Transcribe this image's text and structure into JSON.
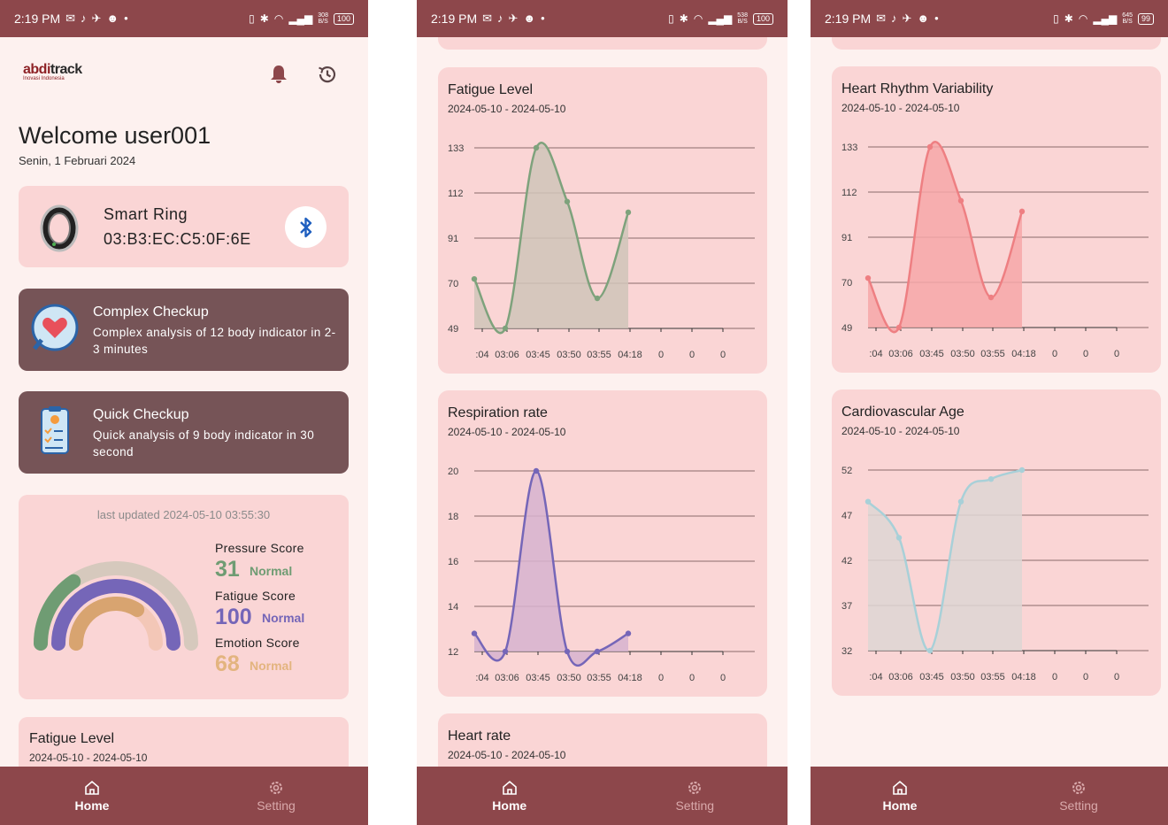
{
  "statusbar": {
    "p1": {
      "time": "2:19 PM",
      "speed_top": "308",
      "speed_bottom": "B/S",
      "battery": "100"
    },
    "p2": {
      "time": "2:19 PM",
      "speed_top": "538",
      "speed_bottom": "B/S",
      "battery": "100"
    },
    "p3": {
      "time": "2:19 PM",
      "speed_top": "645",
      "speed_bottom": "B/S",
      "battery": "99"
    }
  },
  "nav": {
    "home": "Home",
    "setting": "Setting"
  },
  "home": {
    "logo_main_a": "abdi",
    "logo_main_b": "track",
    "logo_sub": "Inovasi Indonesia",
    "welcome": "Welcome user001",
    "date": "Senin, 1 Februari 2024",
    "device": {
      "name": "Smart Ring",
      "mac": "03:B3:EC:C5:0F:6E"
    },
    "complex": {
      "title": "Complex Checkup",
      "desc": "Complex analysis of 12 body indicator in 2-3 minutes"
    },
    "quick": {
      "title": "Quick Checkup",
      "desc": "Quick analysis of 9 body indicator in 30 second"
    },
    "scores": {
      "last_updated": "last updated 2024-05-10 03:55:30",
      "pressure": {
        "label": "Pressure Score",
        "value": "31",
        "status": "Normal",
        "fraction": 0.31
      },
      "fatigue": {
        "label": "Fatigue Score",
        "value": "100",
        "status": "Normal",
        "fraction": 1.0
      },
      "emotion": {
        "label": "Emotion Score",
        "value": "68",
        "status": "Normal",
        "fraction": 0.68
      }
    },
    "fatigue_peek": {
      "title": "Fatigue Level",
      "range": "2024-05-10 - 2024-05-10"
    }
  },
  "colors": {
    "header": "#8d474b",
    "card": "#fad5d5",
    "dark_card": "#765457",
    "pressure": "#6f9c73",
    "fatigue": "#7566b8",
    "emotion": "#d8a470",
    "fatigue_line": "#7ea27c",
    "respiration_line": "#7566b8",
    "hrv_line": "#ee7f82",
    "cardio_line": "#a8d0d8"
  },
  "chart_data": [
    {
      "type": "area",
      "title": "Fatigue Level",
      "subtitle": "2024-05-10 - 2024-05-10",
      "yticks": [
        "133",
        "112",
        "91",
        "70",
        "49"
      ],
      "ylim": [
        49,
        133
      ],
      "xticks": [
        ":04",
        "03:06",
        "03:45",
        "03:50",
        "03:55",
        "04:18",
        "0",
        "0",
        "0"
      ],
      "values": [
        72,
        49,
        133,
        108,
        63,
        103
      ]
    },
    {
      "type": "area",
      "title": "Respiration rate",
      "subtitle": "2024-05-10 - 2024-05-10",
      "yticks": [
        "20",
        "18",
        "16",
        "14",
        "12"
      ],
      "ylim": [
        12,
        20
      ],
      "xticks": [
        ":04",
        "03:06",
        "03:45",
        "03:50",
        "03:55",
        "04:18",
        "0",
        "0",
        "0"
      ],
      "values": [
        12.8,
        12,
        20,
        12,
        12,
        12.8
      ]
    },
    {
      "type": "area",
      "title": "Heart rate",
      "subtitle": "2024-05-10 - 2024-05-10"
    },
    {
      "type": "area",
      "title": "Heart Rhythm Variability",
      "subtitle": "2024-05-10 - 2024-05-10",
      "yticks": [
        "133",
        "112",
        "91",
        "70",
        "49"
      ],
      "ylim": [
        49,
        133
      ],
      "xticks": [
        ":04",
        "03:06",
        "03:45",
        "03:50",
        "03:55",
        "04:18",
        "0",
        "0",
        "0"
      ],
      "values": [
        72,
        49,
        133,
        108,
        63,
        103
      ]
    },
    {
      "type": "area",
      "title": "Cardiovascular Age",
      "subtitle": "2024-05-10 - 2024-05-10",
      "yticks": [
        "52",
        "47",
        "42",
        "37",
        "32"
      ],
      "ylim": [
        32,
        52
      ],
      "xticks": [
        ":04",
        "03:06",
        "03:45",
        "03:50",
        "03:55",
        "04:18",
        "0",
        "0",
        "0"
      ],
      "values": [
        48.5,
        44.5,
        32,
        48.5,
        51,
        52
      ]
    }
  ]
}
